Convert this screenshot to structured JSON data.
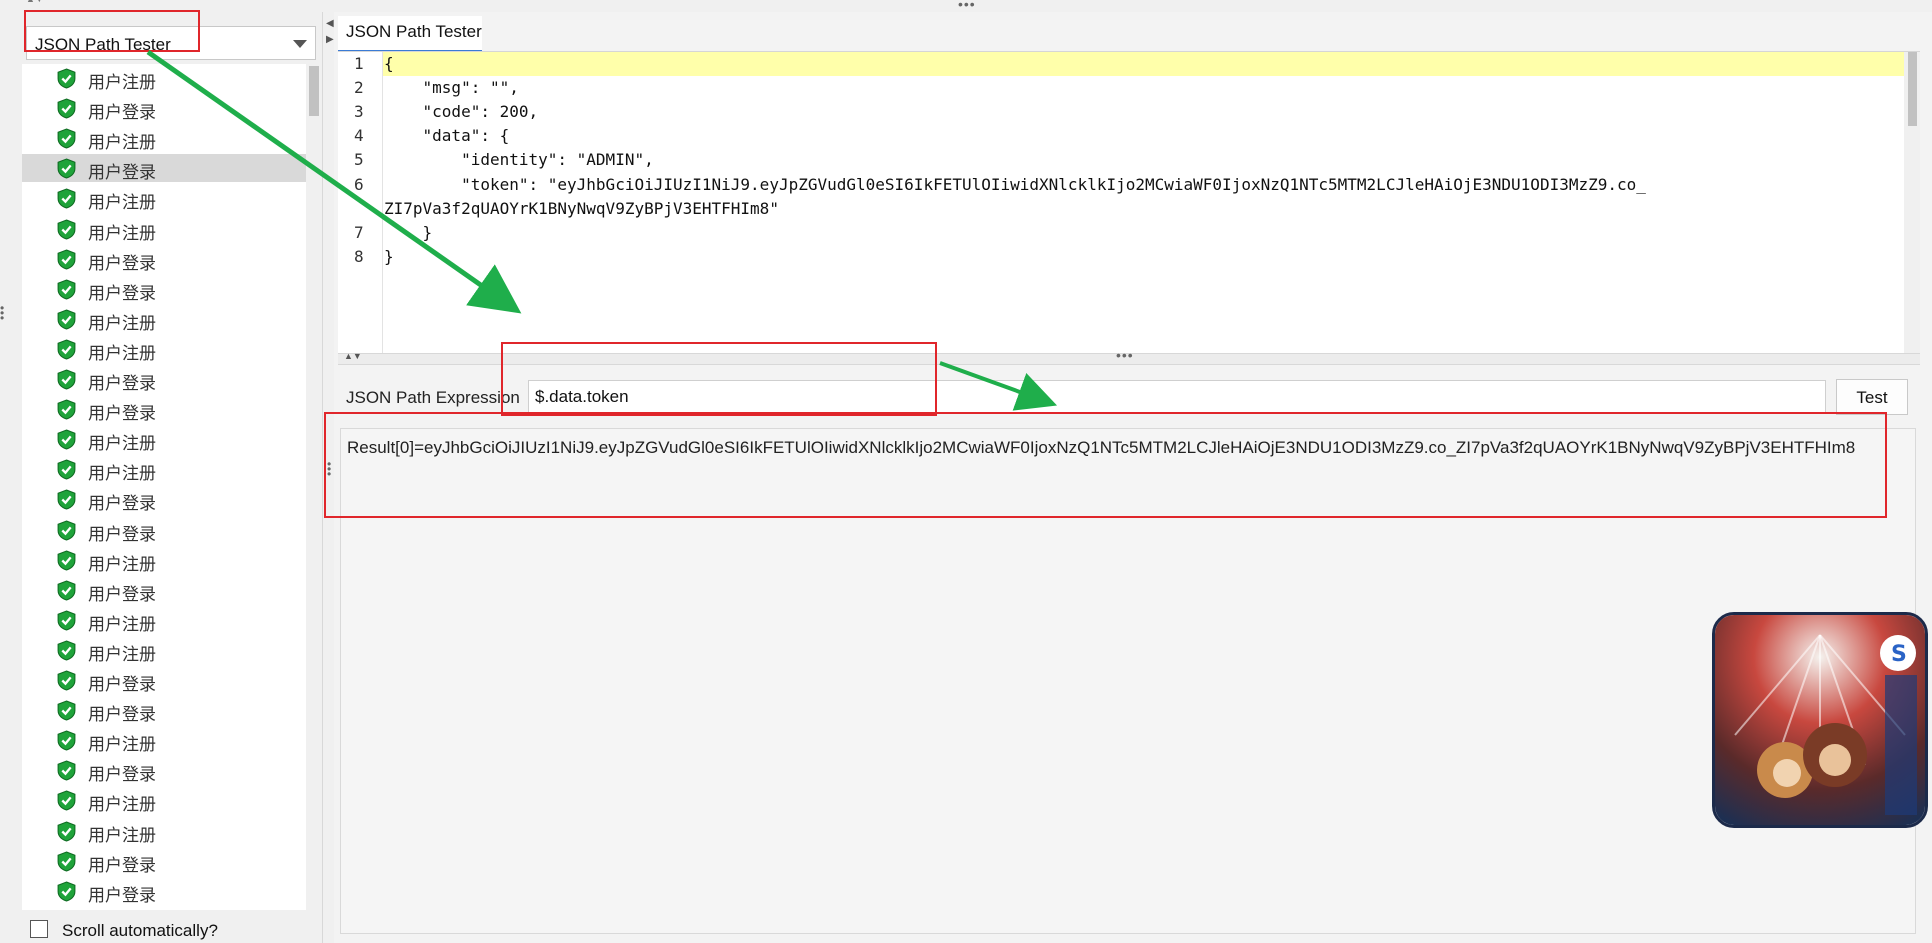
{
  "window": {
    "active_tab": "JSON Path Tester"
  },
  "renderer_select": {
    "value": "JSON Path Tester"
  },
  "tree": {
    "items": [
      {
        "label": "用户注册"
      },
      {
        "label": "用户登录"
      },
      {
        "label": "用户注册"
      },
      {
        "label": "用户登录",
        "selected": true
      },
      {
        "label": "用户注册"
      },
      {
        "label": "用户注册"
      },
      {
        "label": "用户登录"
      },
      {
        "label": "用户登录"
      },
      {
        "label": "用户注册"
      },
      {
        "label": "用户注册"
      },
      {
        "label": "用户登录"
      },
      {
        "label": "用户登录"
      },
      {
        "label": "用户注册"
      },
      {
        "label": "用户注册"
      },
      {
        "label": "用户登录"
      },
      {
        "label": "用户登录"
      },
      {
        "label": "用户注册"
      },
      {
        "label": "用户登录"
      },
      {
        "label": "用户注册"
      },
      {
        "label": "用户注册"
      },
      {
        "label": "用户登录"
      },
      {
        "label": "用户登录"
      },
      {
        "label": "用户注册"
      },
      {
        "label": "用户登录"
      },
      {
        "label": "用户注册"
      },
      {
        "label": "用户注册"
      },
      {
        "label": "用户登录"
      },
      {
        "label": "用户登录"
      }
    ],
    "status_icon": "green-shield-check-icon"
  },
  "scroll_automatically": {
    "label": "Scroll automatically?",
    "checked": false
  },
  "editor": {
    "line_numbers": [
      "1",
      "2",
      "3",
      "4",
      "5",
      "6",
      "",
      "7",
      "8"
    ],
    "lines": [
      "{",
      "    \"msg\": \"\",",
      "    \"code\": 200,",
      "    \"data\": {",
      "        \"identity\": \"ADMIN\",",
      "        \"token\": \"eyJhbGciOiJIUzI1NiJ9.eyJpZGVudGl0eSI6IkFETUlOIiwidXNlcklkIjo2MCwiaWF0IjoxNzQ1NTc5MTM2LCJleHAiOjE3NDU1ODI3MzZ9.co_",
      "ZI7pVa3f2qUAOYrK1BNyNwqV9ZyBPjV3EHTFHIm8\"",
      "    }",
      "}"
    ]
  },
  "expression": {
    "label": "JSON Path Expression",
    "value": "$.data.token"
  },
  "test_button": {
    "label": "Test"
  },
  "result": {
    "text": "Result[0]=eyJhbGciOiJIUzI1NiJ9.eyJpZGVudGl0eSI6IkFETUlOIiwidXNlcklkIjo2MCwiaWF0IjoxNzQ1NTc5MTM2LCJleHAiOjE3NDU1ODI3MzZ9.co_ZI7pVa3f2qUAOYrK1BNyNwqV9ZyBPjV3EHTFHIm8"
  },
  "annotations": {
    "box_color": "#e0262b",
    "arrow_color": "#1fae4b"
  },
  "colors": {
    "line_highlight": "#ffffaa",
    "selected_row": "#d9d9d9",
    "tab_underline": "#3b7bd5"
  }
}
